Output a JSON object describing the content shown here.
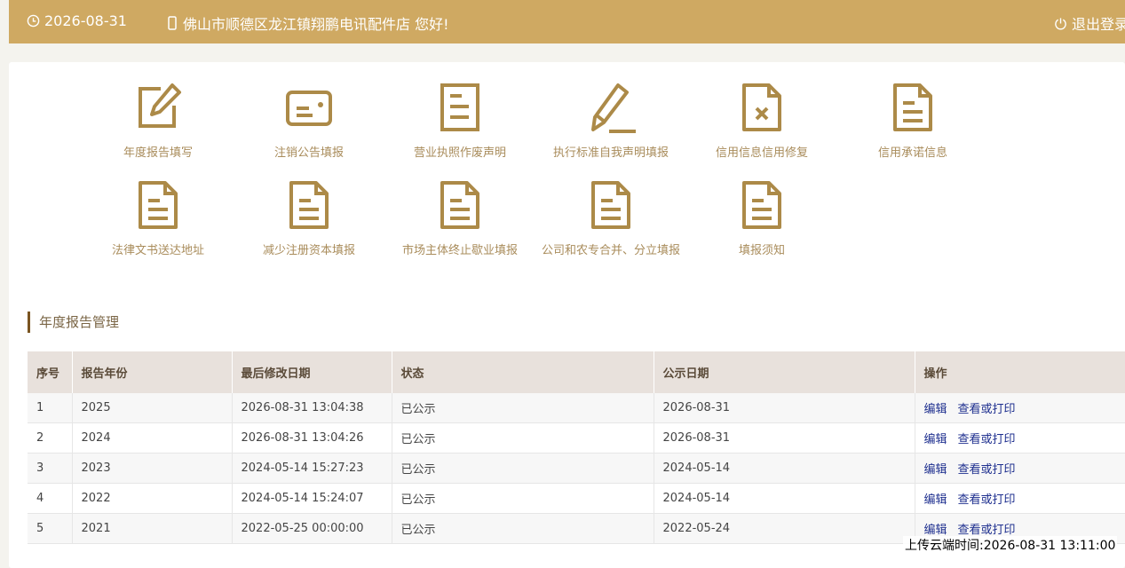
{
  "header": {
    "date": "2026-08-31",
    "greeting": "佛山市顺德区龙江镇翔鹏电讯配件店 您好!",
    "logout_label": "退出登录"
  },
  "menu": [
    {
      "label": "年度报告填写",
      "icon": "edit-square-icon"
    },
    {
      "label": "注销公告填报",
      "icon": "id-card-icon"
    },
    {
      "label": "营业执照作废声明",
      "icon": "document-icon"
    },
    {
      "label": "执行标准自我声明填报",
      "icon": "pencil-icon"
    },
    {
      "label": "信用信息信用修复",
      "icon": "document-x-icon"
    },
    {
      "label": "信用承诺信息",
      "icon": "document-folded-icon"
    },
    {
      "label": "法律文书送达地址",
      "icon": "document-folded-icon"
    },
    {
      "label": "减少注册资本填报",
      "icon": "document-folded-icon"
    },
    {
      "label": "市场主体终止歇业填报",
      "icon": "document-folded-icon"
    },
    {
      "label": "公司和农专合并、分立填报",
      "icon": "document-folded-icon"
    },
    {
      "label": "填报须知",
      "icon": "document-folded-icon"
    }
  ],
  "section": {
    "title": "年度报告管理"
  },
  "table": {
    "headers": [
      "序号",
      "报告年份",
      "最后修改日期",
      "状态",
      "公示日期",
      "操作"
    ],
    "edit_label": "编辑",
    "view_label": "查看或打印",
    "rows": [
      {
        "no": "1",
        "year": "2025",
        "modified": "2026-08-31 13:04:38",
        "status": "已公示",
        "published": "2026-08-31"
      },
      {
        "no": "2",
        "year": "2024",
        "modified": "2026-08-31 13:04:26",
        "status": "已公示",
        "published": "2026-08-31"
      },
      {
        "no": "3",
        "year": "2023",
        "modified": "2024-05-14 15:27:23",
        "status": "已公示",
        "published": "2024-05-14"
      },
      {
        "no": "4",
        "year": "2022",
        "modified": "2024-05-14 15:24:07",
        "status": "已公示",
        "published": "2024-05-14"
      },
      {
        "no": "5",
        "year": "2021",
        "modified": "2022-05-25 00:00:00",
        "status": "已公示",
        "published": "2022-05-24"
      }
    ]
  },
  "footer": {
    "upload_time": "上传云端时间:2026-08-31 13:11:00"
  }
}
